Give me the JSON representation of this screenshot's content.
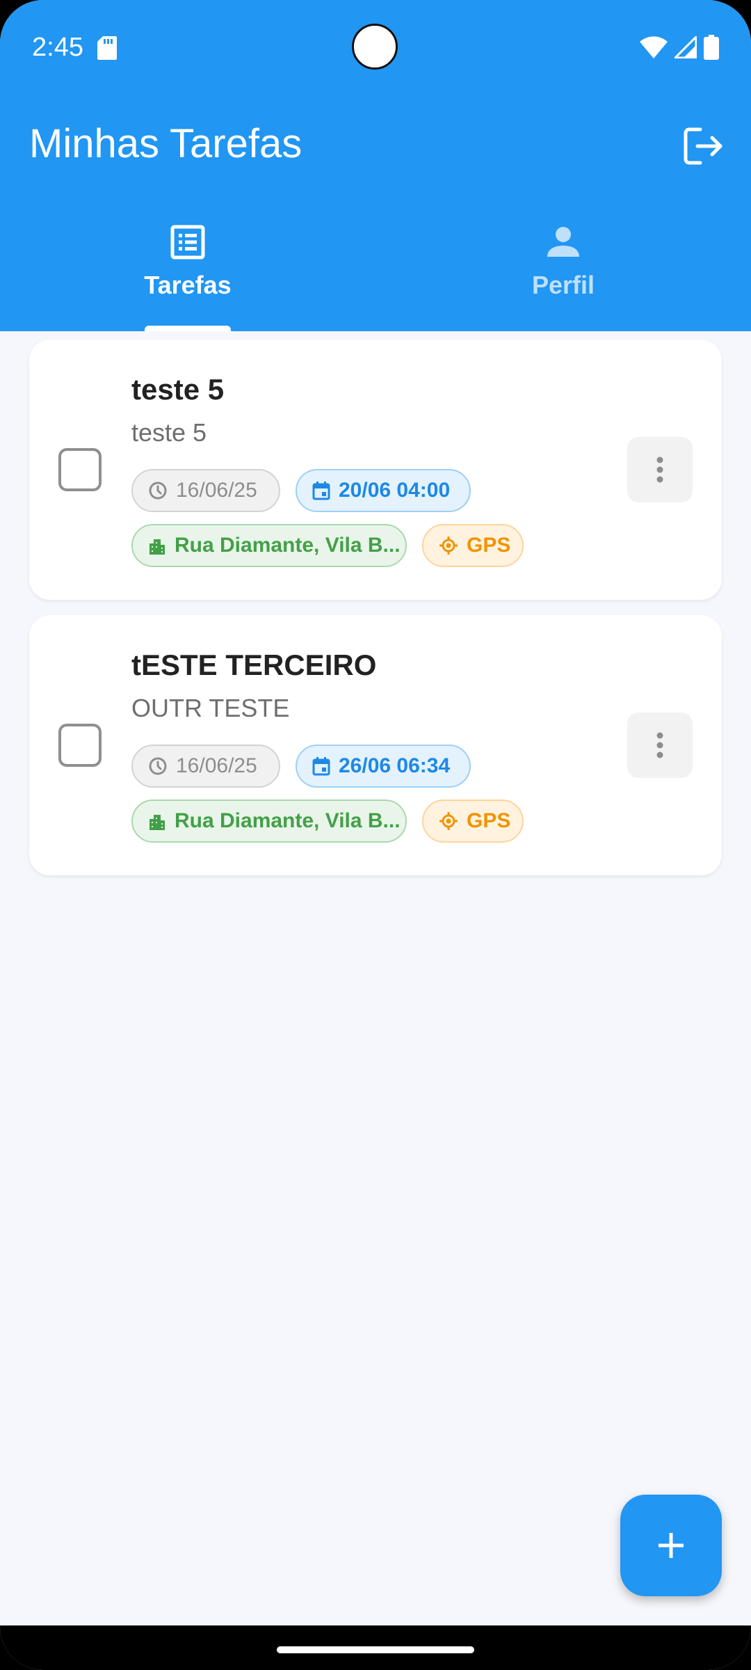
{
  "status_bar": {
    "time": "2:45"
  },
  "app_bar": {
    "title": "Minhas Tarefas"
  },
  "tabs": [
    {
      "label": "Tarefas",
      "icon": "list-icon",
      "active": true
    },
    {
      "label": "Perfil",
      "icon": "person-icon",
      "active": false
    }
  ],
  "tasks": [
    {
      "title": "teste 5",
      "description": "teste 5",
      "created": "16/06/25",
      "due": "20/06 04:00",
      "address": "Rua Diamante, Vila B...",
      "gps": "GPS",
      "checked": false
    },
    {
      "title": "tESTE TERCEIRO",
      "description": "OUTR TESTE",
      "created": "16/06/25",
      "due": "26/06 06:34",
      "address": "Rua Diamante, Vila B...",
      "gps": "GPS",
      "checked": false
    }
  ],
  "colors": {
    "primary": "#2196f3",
    "background": "#f6f7fc",
    "chip_due": "#1e88e5",
    "chip_address": "#43a047",
    "chip_gps": "#f29300"
  }
}
